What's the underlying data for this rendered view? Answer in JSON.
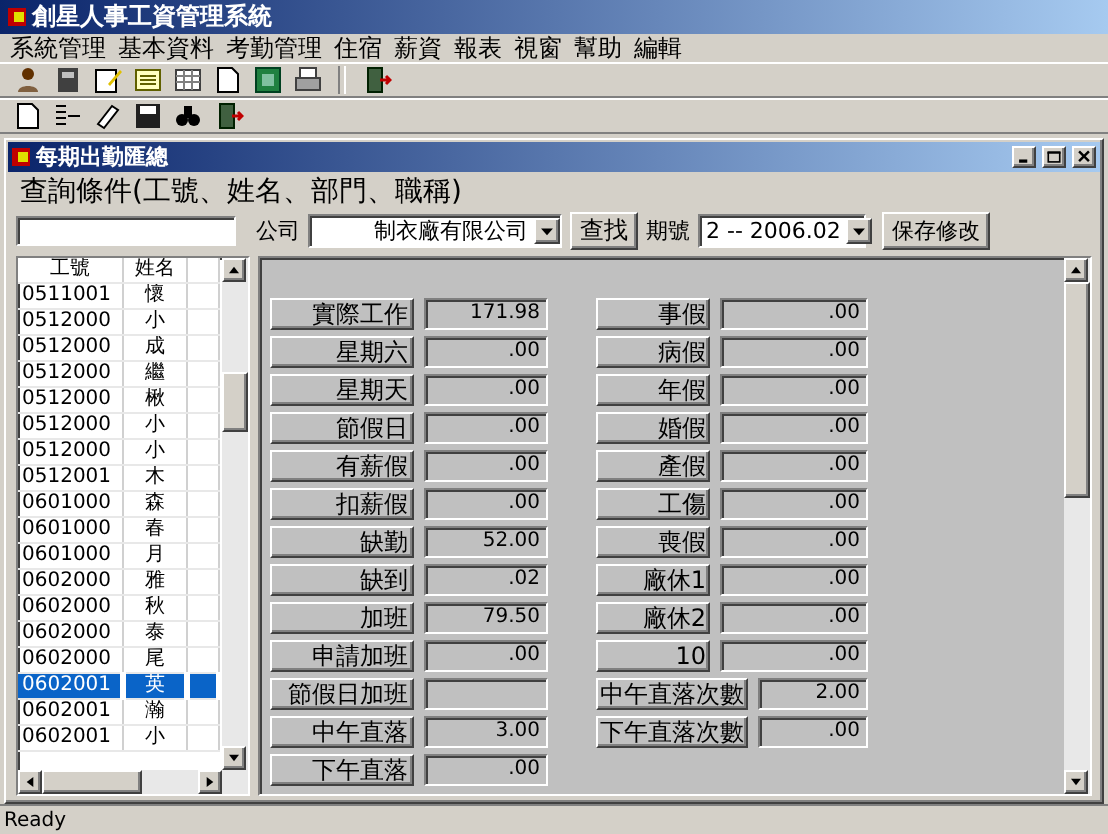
{
  "window": {
    "title": "創星人事工資管理系統"
  },
  "menu": [
    "系統管理",
    "基本資料",
    "考勤管理",
    "住宿",
    "薪資",
    "報表",
    "視窗",
    "幫助",
    "編輯"
  ],
  "child_window": {
    "title": "每期出勤匯總"
  },
  "query": {
    "label": "查詢條件(工號、姓名、部門、職稱)"
  },
  "filter": {
    "company_label": "公司",
    "company_value": "制衣廠有限公司",
    "find_button": "查找",
    "period_label": "期號",
    "period_value": "2 -- 2006.02",
    "save_button": "保存修改"
  },
  "employee_table": {
    "columns": [
      "工號",
      "姓名"
    ],
    "rows": [
      {
        "id": "0511001",
        "name": "懷",
        "selected": false
      },
      {
        "id": "0512000",
        "name": "小",
        "selected": false
      },
      {
        "id": "0512000",
        "name": "成",
        "selected": false
      },
      {
        "id": "0512000",
        "name": "繼",
        "selected": false
      },
      {
        "id": "0512000",
        "name": "楸",
        "selected": false
      },
      {
        "id": "0512000",
        "name": "小",
        "selected": false
      },
      {
        "id": "0512000",
        "name": "小",
        "selected": false
      },
      {
        "id": "0512001",
        "name": "木",
        "selected": false
      },
      {
        "id": "0601000",
        "name": "森",
        "selected": false
      },
      {
        "id": "0601000",
        "name": "春",
        "selected": false
      },
      {
        "id": "0601000",
        "name": "月",
        "selected": false
      },
      {
        "id": "0602000",
        "name": "雅",
        "selected": false
      },
      {
        "id": "0602000",
        "name": "秋",
        "selected": false
      },
      {
        "id": "0602000",
        "name": "泰",
        "selected": false
      },
      {
        "id": "0602000",
        "name": "尾",
        "selected": false
      },
      {
        "id": "0602001",
        "name": "英",
        "selected": true
      },
      {
        "id": "0602001",
        "name": "瀚",
        "selected": false
      },
      {
        "id": "0602001",
        "name": "小",
        "selected": false
      }
    ]
  },
  "attendance_left": [
    {
      "label": "實際工作",
      "value": "171.98"
    },
    {
      "label": "星期六",
      "value": ".00"
    },
    {
      "label": "星期天",
      "value": ".00"
    },
    {
      "label": "節假日",
      "value": ".00"
    },
    {
      "label": "有薪假",
      "value": ".00"
    },
    {
      "label": "扣薪假",
      "value": ".00"
    },
    {
      "label": "缺勤",
      "value": "52.00"
    },
    {
      "label": "缺到",
      "value": ".02"
    },
    {
      "label": "加班",
      "value": "79.50"
    },
    {
      "label": "申請加班",
      "value": ".00"
    },
    {
      "label": "節假日加班"
    },
    {
      "label": "中午直落",
      "value": "3.00"
    },
    {
      "label": "下午直落",
      "value": ".00"
    }
  ],
  "attendance_right": [
    {
      "label": "事假",
      "value": ".00"
    },
    {
      "label": "病假",
      "value": ".00"
    },
    {
      "label": "年假",
      "value": ".00"
    },
    {
      "label": "婚假",
      "value": ".00"
    },
    {
      "label": "產假",
      "value": ".00"
    },
    {
      "label": "工傷",
      "value": ".00"
    },
    {
      "label": "喪假",
      "value": ".00"
    },
    {
      "label": "廠休1",
      "value": ".00"
    },
    {
      "label": "廠休2",
      "value": ".00"
    },
    {
      "label": "10",
      "value": ".00"
    },
    {
      "label": "中午直落次數",
      "value": "2.00"
    },
    {
      "label": "下午直落次數",
      "value": ".00"
    }
  ],
  "status_bar": "Ready"
}
